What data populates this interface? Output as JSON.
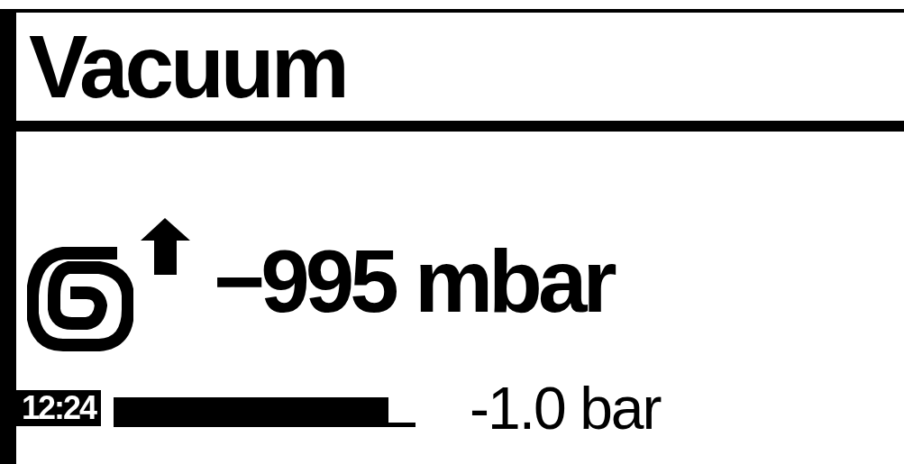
{
  "title": "Vacuum",
  "reading": "−995 mbar",
  "status": {
    "time": "12:24",
    "level": 0.91,
    "setpoint": "-1.0 bar"
  }
}
